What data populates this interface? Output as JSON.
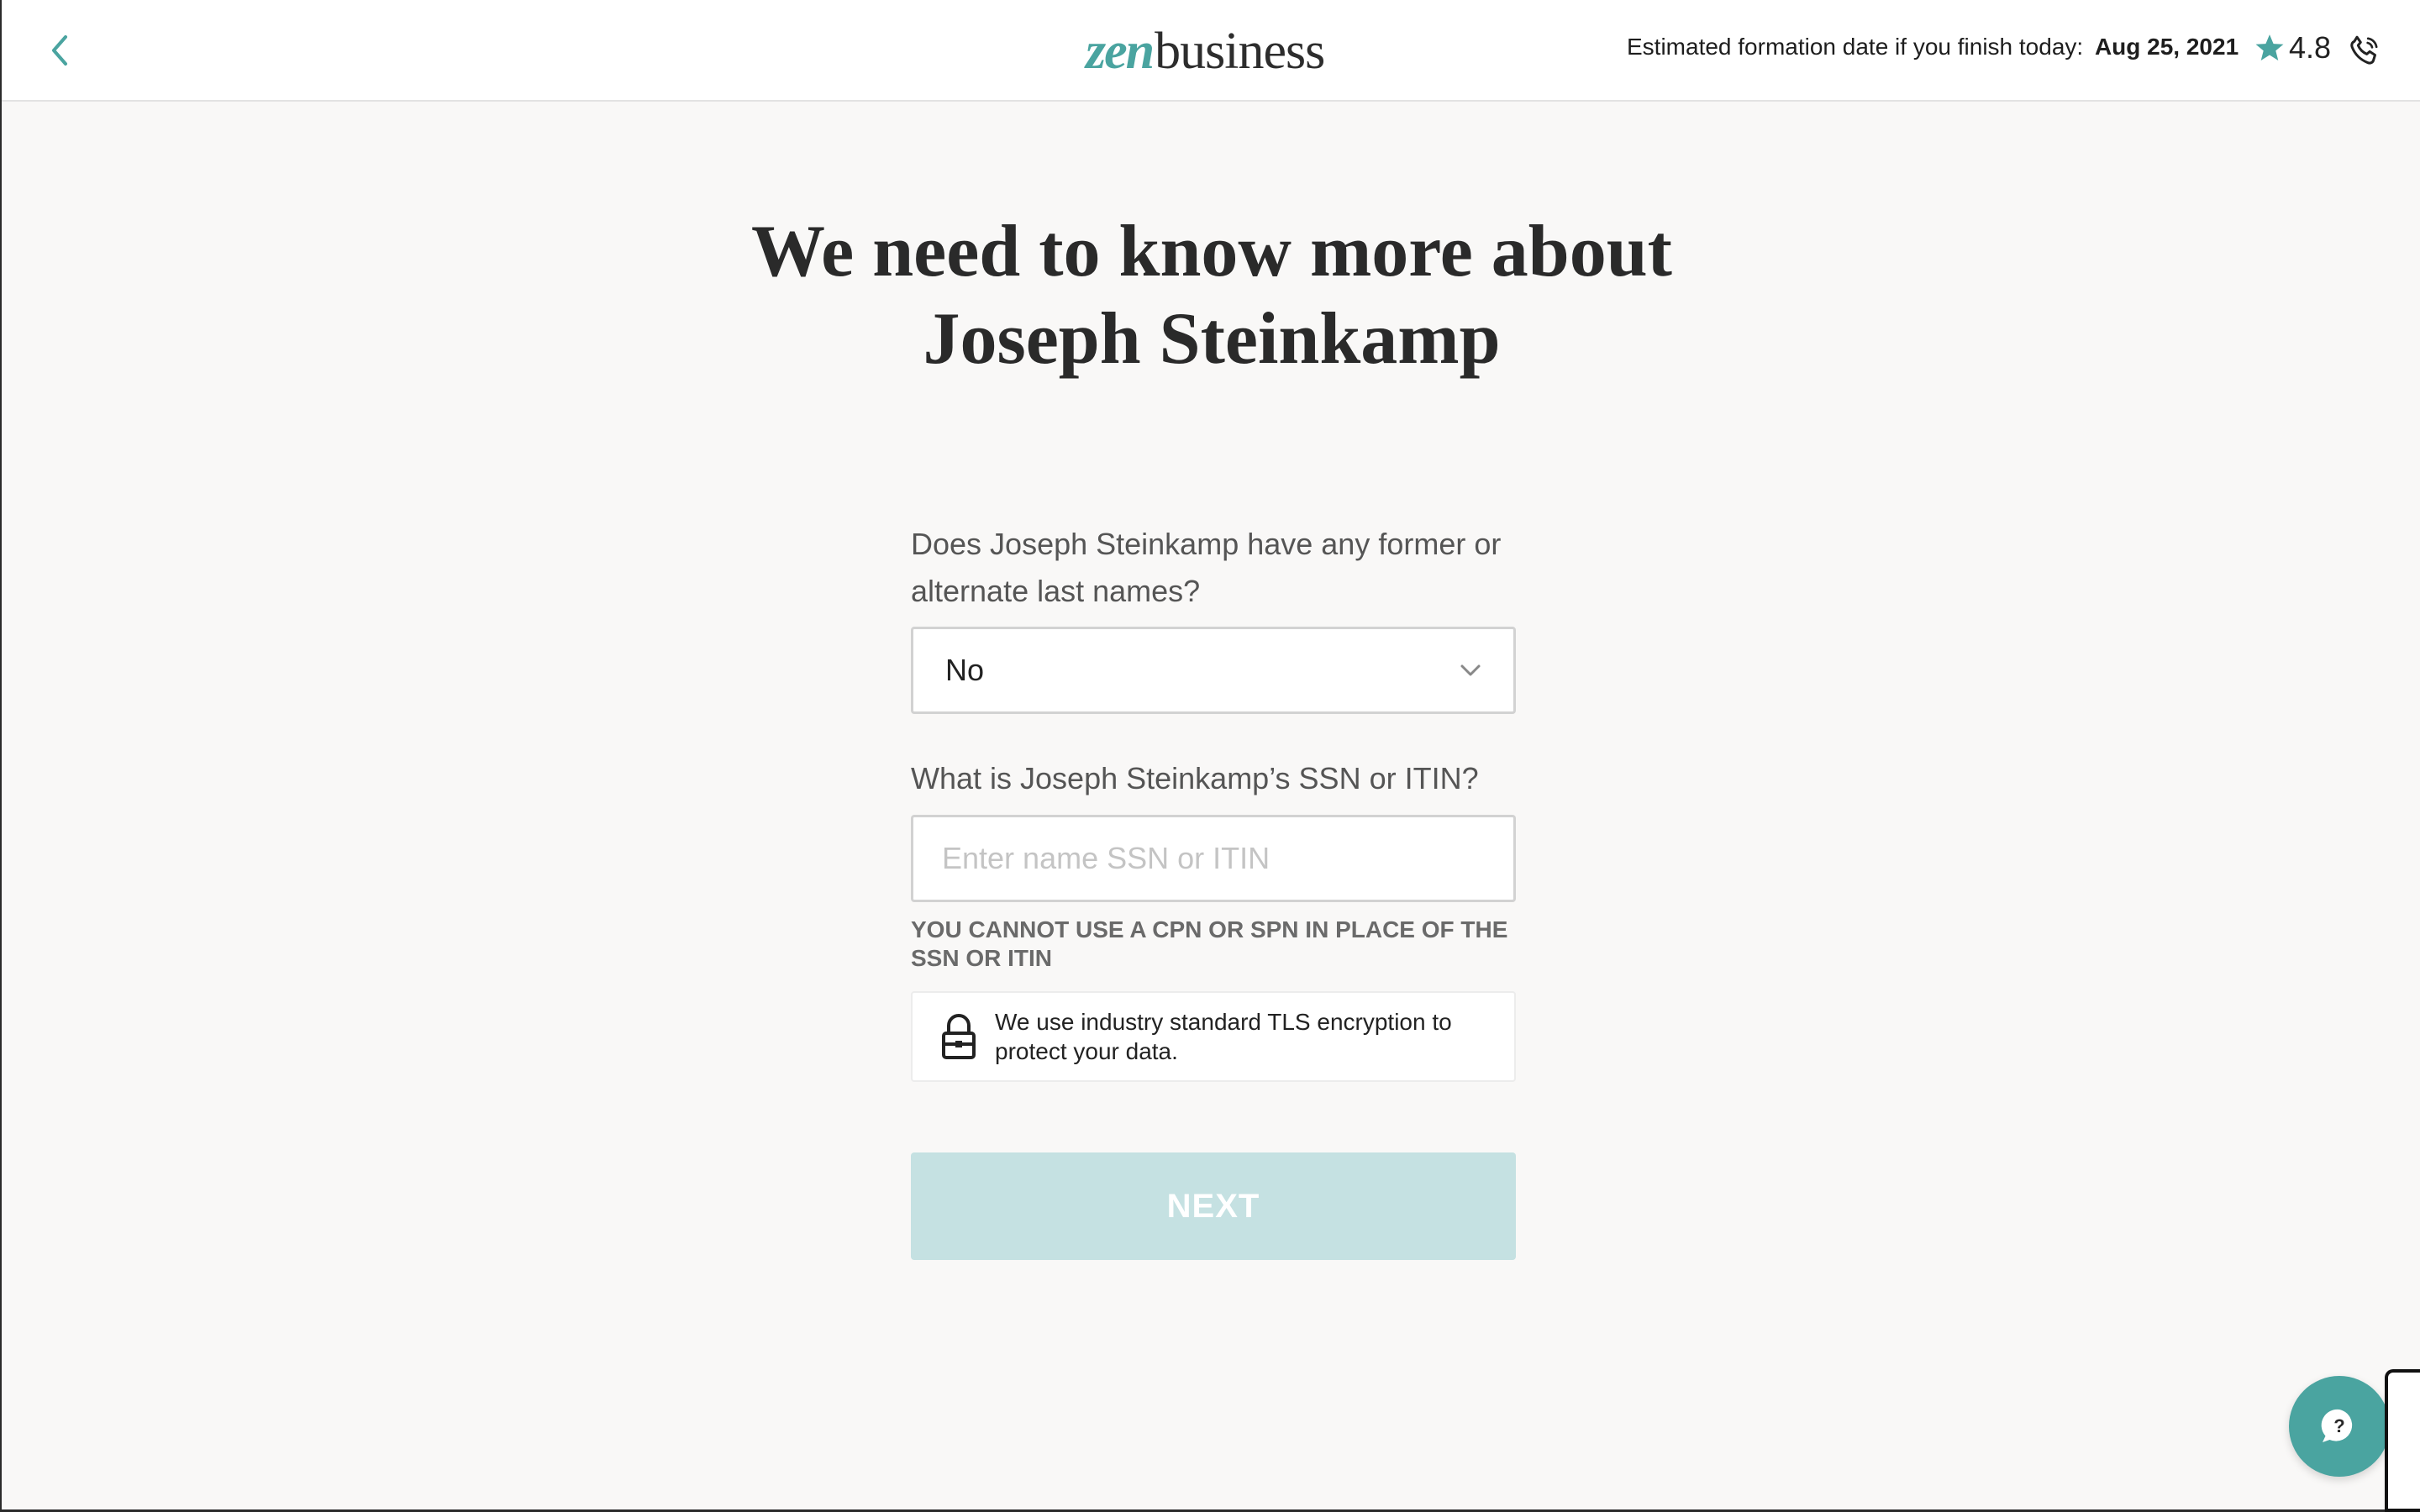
{
  "header": {
    "back_label": "",
    "logo": {
      "part1": "zen",
      "part2": "business"
    },
    "estimate_label": "Estimated formation date if you finish today:",
    "estimate_date": "Aug 25, 2021",
    "rating": "4.8",
    "icons": {
      "back": "chevron-left-icon",
      "star": "star-icon",
      "phone": "phone-icon"
    }
  },
  "main": {
    "title_line1": "We need to know more about",
    "title_line2": "Joseph Steinkamp",
    "question_names": "Does Joseph Steinkamp have any former or alternate last names?",
    "names_selected": "No",
    "question_ssn": "What is Joseph Steinkamp’s SSN or ITIN?",
    "ssn_value": "",
    "ssn_placeholder": "Enter name SSN or ITIN",
    "cpn_note": "YOU CANNOT USE A CPN OR SPN IN PLACE OF THE SSN OR ITIN",
    "secure_text": "We use industry standard TLS encryption to protect your data.",
    "next_label": "NEXT"
  },
  "colors": {
    "accent": "#4aa4a0",
    "next_disabled": "#c5e1e2",
    "background": "#f9f8f7"
  }
}
